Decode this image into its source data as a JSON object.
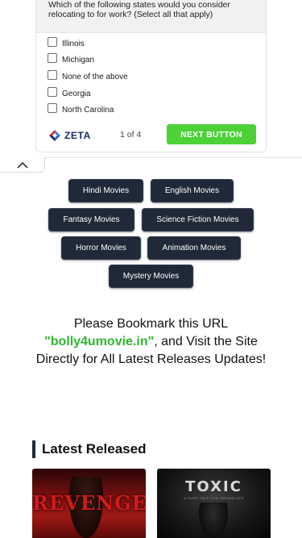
{
  "ad": {
    "question": "Which of the following states would you consider relocating to for work? (Select all that apply)",
    "options": [
      "Illinois",
      "Michigan",
      "None of the above",
      "Georgia",
      "North Carolina"
    ],
    "brand": "ZETA",
    "pager": "1 of 4",
    "next_label": "NEXT BUTTON"
  },
  "genres": [
    "Hindi Movies",
    "English Movies",
    "Fantasy Movies",
    "Science Fiction Movies",
    "Horror Movies",
    "Animation Movies",
    "Mystery Movies"
  ],
  "bookmark": {
    "prefix": "Please Bookmark this URL",
    "url": "\"bolly4umovie.in\"",
    "suffix": ", and Visit the Site Directly for All Latest Releases Updates!"
  },
  "latest": {
    "heading": "Latest Released",
    "posters": [
      {
        "title": "REVENGE"
      },
      {
        "title": "TOXIC",
        "tagline": "A FAIRY TALE FOR GROWN-UPS"
      }
    ]
  },
  "colors": {
    "accent_green": "#4cd137",
    "url_green": "#2eb82e",
    "button_dark": "#1f2937",
    "zeta_navy": "#1b2a5c"
  }
}
